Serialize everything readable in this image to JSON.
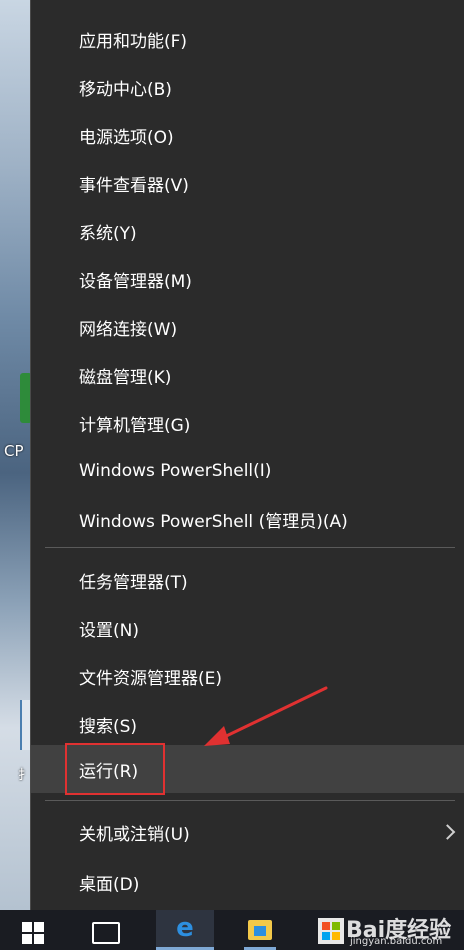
{
  "desktop": {
    "icon_label_1": "CP",
    "icon_label_2": "扌"
  },
  "menu": {
    "group1": [
      {
        "label": "应用和功能(F)"
      },
      {
        "label": "移动中心(B)"
      },
      {
        "label": "电源选项(O)"
      },
      {
        "label": "事件查看器(V)"
      },
      {
        "label": "系统(Y)"
      },
      {
        "label": "设备管理器(M)"
      },
      {
        "label": "网络连接(W)"
      },
      {
        "label": "磁盘管理(K)"
      },
      {
        "label": "计算机管理(G)"
      },
      {
        "label": "Windows PowerShell(I)"
      },
      {
        "label": "Windows PowerShell (管理员)(A)"
      }
    ],
    "group2": [
      {
        "label": "任务管理器(T)"
      },
      {
        "label": "设置(N)"
      },
      {
        "label": "文件资源管理器(E)"
      },
      {
        "label": "搜索(S)"
      },
      {
        "label": "运行(R)",
        "highlighted": true
      }
    ],
    "group3": [
      {
        "label": "关机或注销(U)",
        "submenu": true
      },
      {
        "label": "桌面(D)"
      }
    ]
  },
  "taskbar": {
    "edge_glyph": "e",
    "watermark": "Bai度经验",
    "watermark_sub": "jingyan.baidu.com"
  },
  "colors": {
    "menu_bg": "#2b2b2b",
    "hover_bg": "#414141",
    "highlight_border": "#e03131",
    "arrow": "#e03131"
  }
}
